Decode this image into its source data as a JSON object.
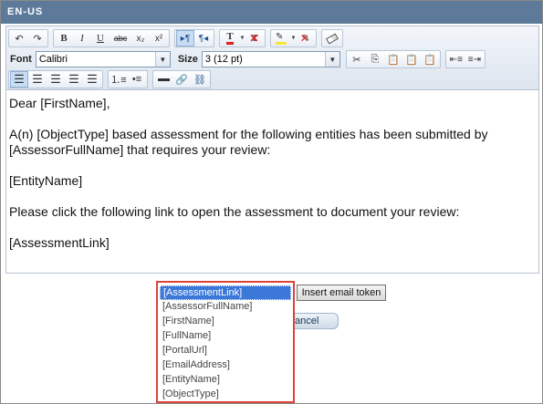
{
  "header": {
    "title": "EN-US"
  },
  "toolbar": {
    "font_label": "Font",
    "font_value": "Calibri",
    "size_label": "Size",
    "size_value": "3 (12 pt)",
    "bold": "B",
    "italic": "I",
    "underline": "U",
    "strike": "abc",
    "subscript": "x₂",
    "superscript": "x²",
    "font_color_sample": "T",
    "font_color": "#e02020",
    "highlight_color": "#f5e63c"
  },
  "editor": {
    "paragraphs": [
      "Dear [FirstName],",
      "A(n) [ObjectType] based assessment for the following entities has been submitted by [AssessorFullName] that requires your review:",
      "[EntityName]",
      "Please click the following link to open the assessment to document your review:",
      "[AssessmentLink]"
    ]
  },
  "tokens": {
    "items": [
      "[AssessmentLink]",
      "[AssessorFullName]",
      "[FirstName]",
      "[FullName]",
      "[PortalUrl]",
      "[EmailAddress]",
      "[EntityName]",
      "[ObjectType]"
    ],
    "selected_index": 0,
    "insert_label": "Insert email token"
  },
  "actions": {
    "cancel_label": "ancel"
  }
}
